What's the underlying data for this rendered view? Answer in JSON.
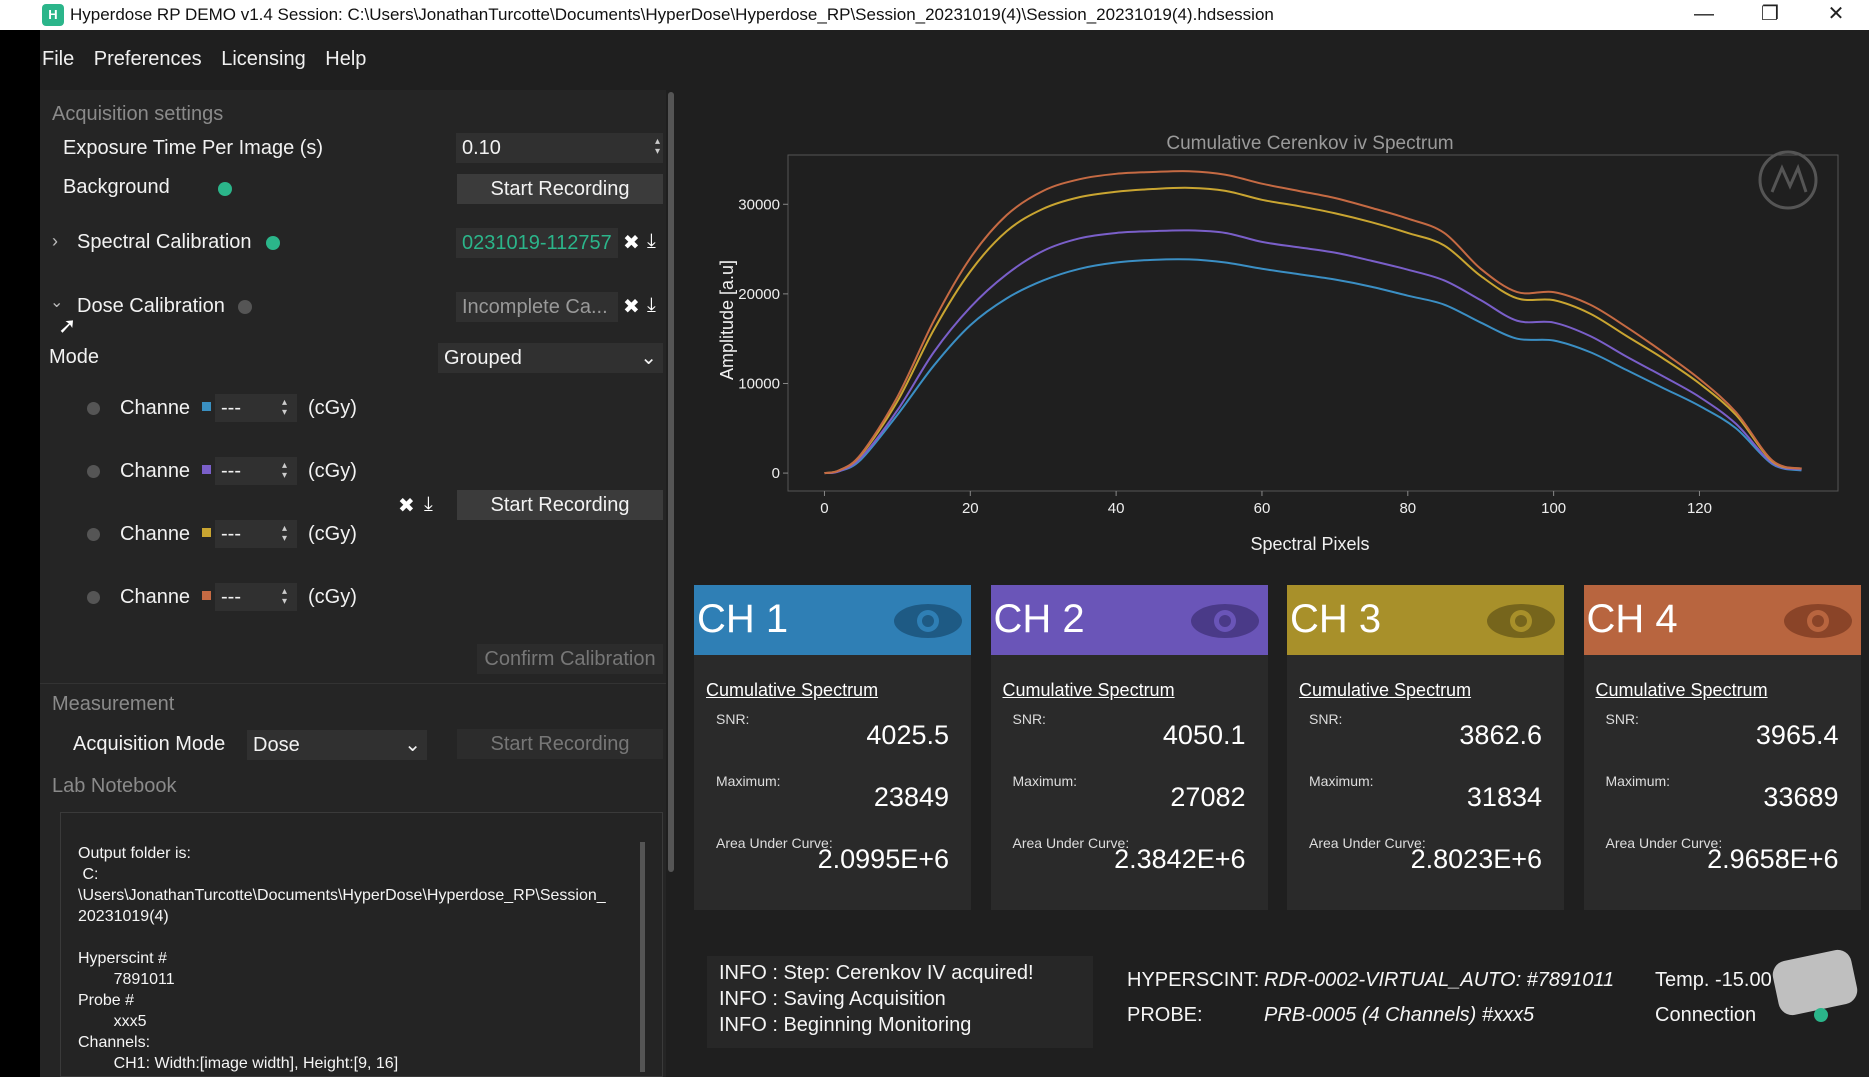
{
  "window": {
    "title": "Hyperdose RP DEMO v1.4 Session: C:\\Users\\JonathanTurcotte\\Documents\\HyperDose\\Hyperdose_RP\\Session_20231019(4)\\Session_20231019(4).hdsession",
    "minimize": "—",
    "restore": "❐",
    "close": "✕"
  },
  "menu": [
    "File",
    "Preferences",
    "Licensing",
    "Help"
  ],
  "acquisition": {
    "section_title": "Acquisition settings",
    "exposure_label": "Exposure Time Per Image (s)",
    "exposure_value": "0.10",
    "background_label": "Background",
    "background_status_color": "#2bb58a",
    "start_recording": "Start Recording"
  },
  "spectral": {
    "label": "Spectral Calibration",
    "status_color": "#2bb58a",
    "file_value": "0231019-112757",
    "file_color": "#2bb58a"
  },
  "dose": {
    "label": "Dose Calibration",
    "status_color": "#555555",
    "file_value": "Incomplete Ca...",
    "mode_label": "Mode",
    "mode_value": "Grouped",
    "channels": [
      {
        "label": "Channe",
        "value": "---",
        "unit": "(cGy)",
        "color": "#3a8fc0"
      },
      {
        "label": "Channe",
        "value": "---",
        "unit": "(cGy)",
        "color": "#7a5fc9"
      },
      {
        "label": "Channe",
        "value": "---",
        "unit": "(cGy)",
        "color": "#c9a531"
      },
      {
        "label": "Channe",
        "value": "---",
        "unit": "(cGy)",
        "color": "#c56a43"
      }
    ],
    "start_recording": "Start Recording",
    "confirm": "Confirm Calibration"
  },
  "measurement": {
    "section_title": "Measurement",
    "acq_mode_label": "Acquisition Mode",
    "acq_mode_value": "Dose",
    "start_recording": "Start Recording"
  },
  "notebook": {
    "section_title": "Lab Notebook",
    "lines": [
      "Output folder is:",
      " C:",
      "\\Users\\JonathanTurcotte\\Documents\\HyperDose\\Hyperdose_RP\\Session_",
      "20231019(4)",
      "",
      "Hyperscint #",
      "        7891011",
      "Probe #",
      "        xxx5",
      "Channels:",
      "        CH1: Width:[image width], Height:[9, 16]"
    ]
  },
  "chart_data": {
    "type": "line",
    "title": "Cumulative Cerenkov iv Spectrum",
    "xlabel": "Spectral Pixels",
    "ylabel": "Amplitude [a.u]",
    "xlim": [
      -5,
      139
    ],
    "ylim": [
      -2000,
      35500
    ],
    "xticks": [
      0,
      20,
      40,
      60,
      80,
      100,
      120
    ],
    "yticks": [
      0,
      10000,
      20000,
      30000
    ],
    "x": [
      0,
      2,
      5,
      10,
      15,
      20,
      25,
      30,
      35,
      40,
      45,
      50,
      55,
      60,
      65,
      70,
      75,
      80,
      85,
      90,
      95,
      100,
      105,
      110,
      115,
      120,
      125,
      130,
      134
    ],
    "series": [
      {
        "color": "#3b8fc4",
        "values": [
          0,
          200,
          1500,
          6500,
          12000,
          16500,
          19500,
          21500,
          22800,
          23500,
          23800,
          23849,
          23500,
          22800,
          22200,
          21600,
          20800,
          19800,
          18800,
          16800,
          15000,
          14800,
          13500,
          11500,
          9500,
          7500,
          5000,
          1000,
          300
        ]
      },
      {
        "color": "#7a5fc9",
        "values": [
          0,
          200,
          1700,
          7000,
          13500,
          18500,
          22200,
          24800,
          26200,
          26800,
          27000,
          27082,
          26800,
          25800,
          25200,
          24600,
          23700,
          22700,
          21500,
          19300,
          17000,
          16800,
          15300,
          13000,
          10800,
          8500,
          5500,
          1100,
          400
        ]
      },
      {
        "color": "#c9a531",
        "values": [
          0,
          300,
          2000,
          8000,
          16000,
          22500,
          27000,
          29500,
          30800,
          31400,
          31700,
          31834,
          31500,
          30500,
          29800,
          29000,
          28000,
          26800,
          25400,
          22000,
          19500,
          19300,
          17800,
          15300,
          12800,
          10000,
          6500,
          1300,
          500
        ]
      },
      {
        "color": "#c56a43",
        "values": [
          0,
          300,
          2100,
          8500,
          17000,
          24000,
          28800,
          31500,
          32800,
          33400,
          33600,
          33689,
          33300,
          32300,
          31500,
          30700,
          29600,
          28400,
          26800,
          22800,
          20200,
          20200,
          18800,
          16300,
          13500,
          10500,
          6800,
          1400,
          500
        ]
      }
    ],
    "grid": false,
    "legend": "none"
  },
  "channels": [
    {
      "name": "CH 1",
      "color": "#2f7fb5",
      "eye_color": "#1e5a84",
      "cum_label": "Cumulative Spectrum",
      "snr_label": "SNR:",
      "snr": "4025.5",
      "max_label": "Maximum:",
      "max": "23849",
      "auc_label": "Area Under Curve:",
      "auc": "2.0995E+6"
    },
    {
      "name": "CH 2",
      "color": "#6a55b8",
      "eye_color": "#4a3a88",
      "cum_label": "Cumulative Spectrum",
      "snr_label": "SNR:",
      "snr": "4050.1",
      "max_label": "Maximum:",
      "max": "27082",
      "auc_label": "Area Under Curve:",
      "auc": "2.3842E+6"
    },
    {
      "name": "CH 3",
      "color": "#a8902a",
      "eye_color": "#76651c",
      "cum_label": "Cumulative Spectrum",
      "snr_label": "SNR:",
      "snr": "3862.6",
      "max_label": "Maximum:",
      "max": "31834",
      "auc_label": "Area Under Curve:",
      "auc": "2.8023E+6"
    },
    {
      "name": "CH 4",
      "color": "#b8653f",
      "eye_color": "#8a4428",
      "cum_label": "Cumulative Spectrum",
      "snr_label": "SNR:",
      "snr": "3965.4",
      "max_label": "Maximum:",
      "max": "33689",
      "auc_label": "Area Under Curve:",
      "auc": "2.9658E+6"
    }
  ],
  "log": [
    "INFO : Step: Cerenkov IV acquired!",
    "INFO : Saving Acquisition",
    "INFO : Beginning Monitoring"
  ],
  "status": {
    "hyperscint_label": "HYPERSCINT:",
    "hyperscint_value": "RDR-0002-VIRTUAL_AUTO: #7891011",
    "probe_label": "PROBE:",
    "probe_value": "PRB-0005 (4 Channels) #xxx5",
    "temp": "Temp. -15.00°C",
    "connection": "Connection",
    "connection_color": "#2bb58a"
  }
}
